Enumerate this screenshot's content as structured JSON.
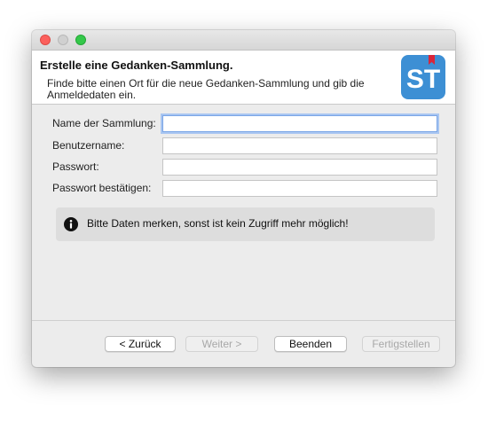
{
  "window": {
    "controls": [
      "close",
      "minimize",
      "maximize"
    ]
  },
  "header": {
    "title": "Erstelle eine Gedanken-Sammlung.",
    "description": "Finde bitte einen Ort für die neue Gedanken-Sammlung und gib die Anmeldedaten ein.",
    "logo_text": "ST",
    "logo_color": "#3d8fd4",
    "logo_ribbon_color": "#d9263a"
  },
  "form": {
    "fields": [
      {
        "label": "Name der Sammlung:",
        "value": "",
        "focused": true
      },
      {
        "label": "Benutzername:",
        "value": ""
      },
      {
        "label": "Passwort:",
        "value": ""
      },
      {
        "label": "Passwort bestätigen:",
        "value": ""
      }
    ]
  },
  "info": {
    "icon": "info-icon",
    "text": "Bitte Daten merken, sonst ist kein Zugriff mehr möglich!"
  },
  "buttons": {
    "back": "< Zurück",
    "next": "Weiter >",
    "cancel": "Beenden",
    "finish": "Fertigstellen"
  }
}
